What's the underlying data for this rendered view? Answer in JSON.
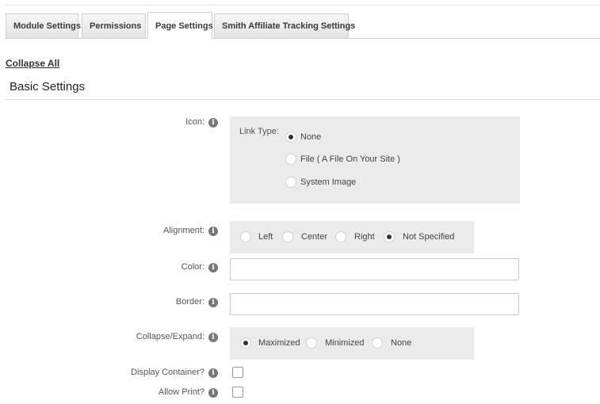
{
  "tabs": [
    {
      "label": "Module Settings"
    },
    {
      "label": "Permissions"
    },
    {
      "label": "Page Settings"
    },
    {
      "label": "Smith Affiliate Tracking Settings"
    }
  ],
  "active_tab": "Page Settings",
  "collapse_all": "Collapse All",
  "section_title": "Basic Settings",
  "info_glyph": "i",
  "icon_field": {
    "label": "Icon:",
    "link_type_label": "Link Type:",
    "options": [
      "None",
      "File ( A File On Your Site )",
      "System Image"
    ],
    "selected": "None"
  },
  "alignment": {
    "label": "Alignment:",
    "options": [
      "Left",
      "Center",
      "Right",
      "Not Specified"
    ],
    "selected": "Not Specified"
  },
  "color": {
    "label": "Color:",
    "value": ""
  },
  "border": {
    "label": "Border:",
    "value": ""
  },
  "collapse_expand": {
    "label": "Collapse/Expand:",
    "options": [
      "Maximized",
      "Minimized",
      "None"
    ],
    "selected": "Maximized"
  },
  "display_container": {
    "label": "Display Container?",
    "checked": false
  },
  "allow_print": {
    "label": "Allow Print?",
    "checked": false
  }
}
